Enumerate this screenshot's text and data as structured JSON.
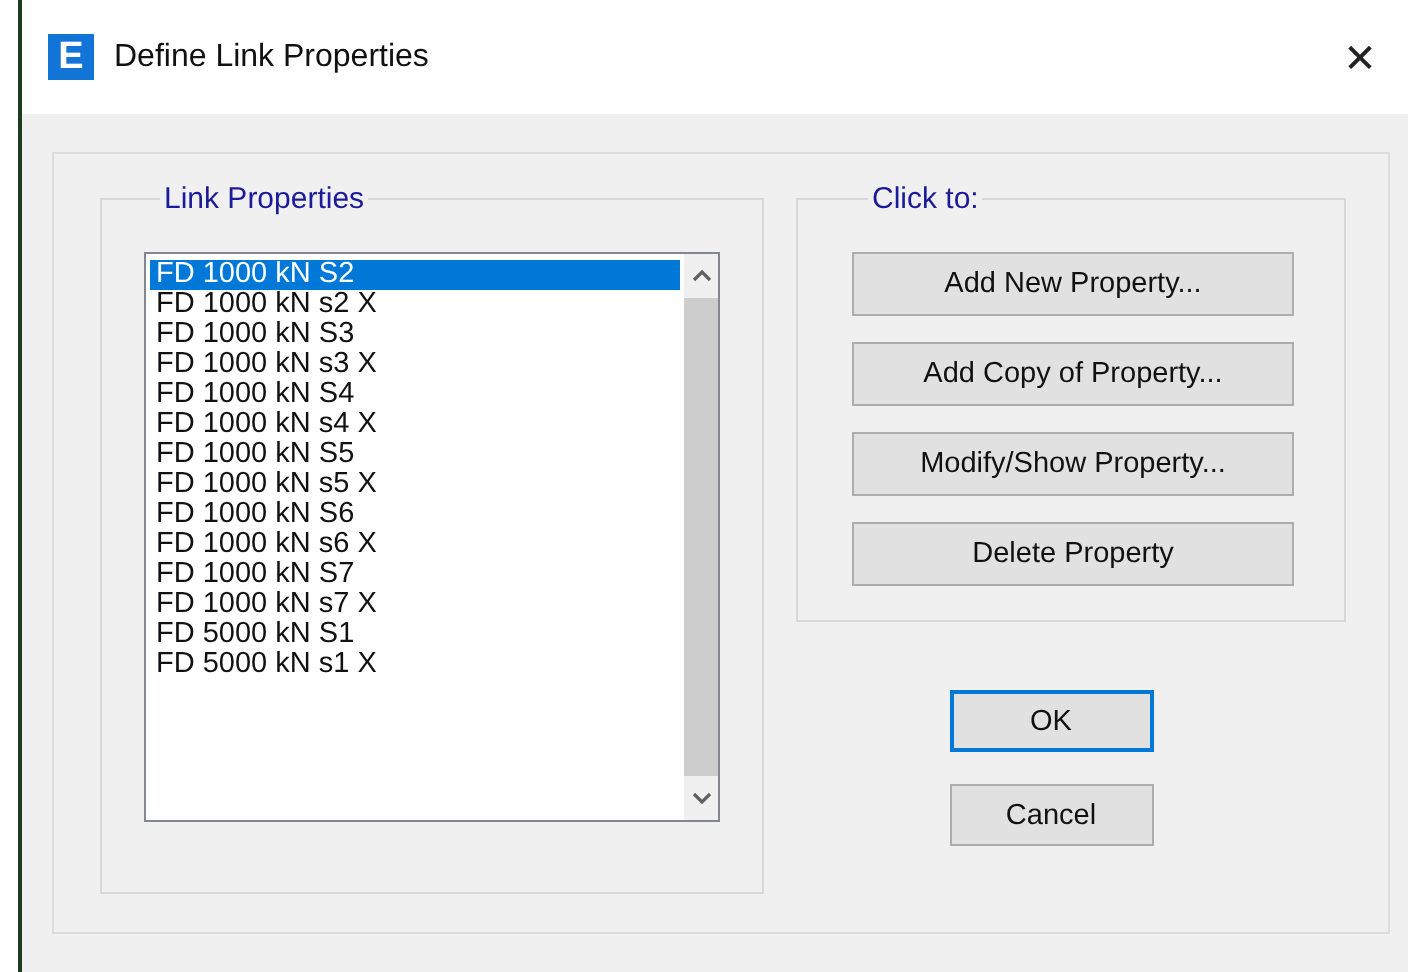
{
  "window": {
    "icon_letter": "E",
    "title": "Define Link Properties",
    "close": "✕"
  },
  "link_properties": {
    "label": "Link Properties",
    "items": [
      {
        "text": "FD 1000 kN S2",
        "selected": true
      },
      {
        "text": "FD 1000 kN s2 X",
        "selected": false
      },
      {
        "text": "FD 1000 kN S3",
        "selected": false
      },
      {
        "text": "FD 1000 kN s3 X",
        "selected": false
      },
      {
        "text": "FD 1000 kN S4",
        "selected": false
      },
      {
        "text": "FD 1000 kN s4 X",
        "selected": false
      },
      {
        "text": "FD 1000 kN S5",
        "selected": false
      },
      {
        "text": "FD 1000 kN s5 X",
        "selected": false
      },
      {
        "text": "FD 1000 kN S6",
        "selected": false
      },
      {
        "text": "FD 1000 kN s6 X",
        "selected": false
      },
      {
        "text": "FD 1000 kN S7",
        "selected": false
      },
      {
        "text": "FD 1000 kN s7 X",
        "selected": false
      },
      {
        "text": "FD 5000 kN S1",
        "selected": false
      },
      {
        "text": "FD 5000 kN s1 X",
        "selected": false
      }
    ]
  },
  "click_to": {
    "label": "Click to:",
    "buttons": [
      "Add New Property...",
      "Add Copy of Property...",
      "Modify/Show Property...",
      "Delete Property"
    ]
  },
  "buttons": [
    {
      "label": "OK",
      "focused": true
    },
    {
      "label": "Cancel",
      "focused": false
    }
  ]
}
